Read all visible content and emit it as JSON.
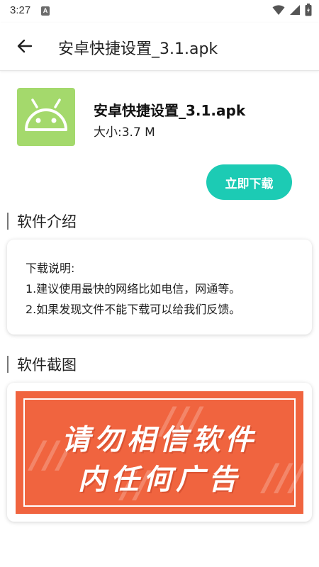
{
  "status_bar": {
    "time": "3:27",
    "notification_icon": "a-badge-icon",
    "icons": [
      "wifi-icon",
      "signal-icon",
      "battery-icon"
    ]
  },
  "app_bar": {
    "back_icon": "arrow-left-icon",
    "title": "安卓快捷设置_3.1.apk"
  },
  "app_info": {
    "icon": "android-icon",
    "icon_color": "#a4d96c",
    "name": "安卓快捷设置_3.1.apk",
    "size": "大小:3.7 M"
  },
  "download_button": {
    "label": "立即下载",
    "color": "#1ccbb4"
  },
  "intro_section": {
    "title": "软件介绍",
    "lines": [
      "下载说明:",
      "1.建议使用最快的网络比如电信，网通等。",
      "2.如果发现文件不能下载可以给我们反馈。"
    ]
  },
  "screenshot_section": {
    "title": "软件截图",
    "banner_lines": [
      "请勿相信软件",
      "内任何广告"
    ],
    "banner_color": "#f0643f"
  }
}
